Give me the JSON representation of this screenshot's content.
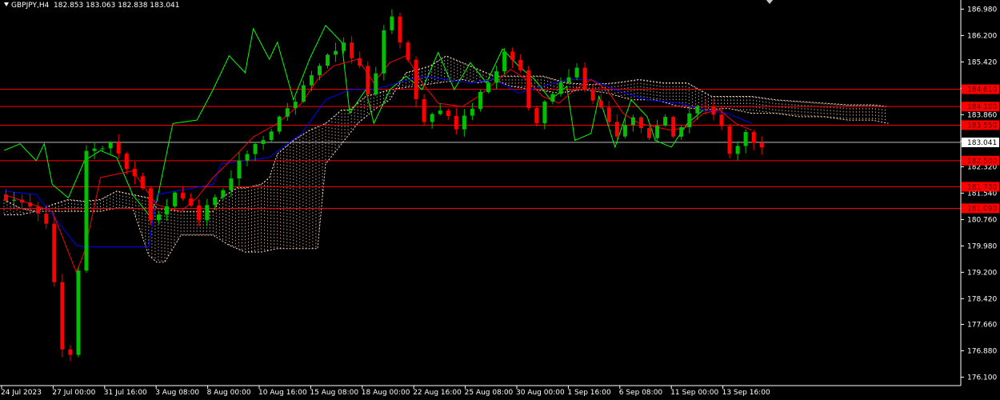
{
  "header": {
    "symbol": "GBPJPY,H4",
    "ohlc": "182.853 183.063 182.838 183.041"
  },
  "colors": {
    "background": "#000000",
    "bull_candle": "#00c000",
    "bear_candle": "#ff0000",
    "tenkan": "#ff0000",
    "kijun": "#0000ff",
    "chikou": "#00ff00",
    "cloud_hatch": "#ffd8c0",
    "level_line": "#ff0000",
    "price_line": "#ffffff",
    "axis": "#ffffff"
  },
  "chart_data": {
    "type": "candlestick",
    "title": "GBPJPY,H4",
    "ylim": [
      175.85,
      187.25
    ],
    "y_ticks": [
      "186.980",
      "186.200",
      "185.420",
      "184.640",
      "183.860",
      "183.080",
      "182.320",
      "181.540",
      "180.760",
      "179.980",
      "179.200",
      "178.420",
      "177.660",
      "176.880",
      "176.100"
    ],
    "x_ticks": [
      "24 Jul 2023",
      "27 Jul 00:00",
      "31 Jul 16:00",
      "3 Aug 08:00",
      "8 Aug 00:00",
      "10 Aug 16:00",
      "15 Aug 08:00",
      "18 Aug 00:00",
      "22 Aug 16:00",
      "25 Aug 08:00",
      "30 Aug 00:00",
      "1 Sep 16:00",
      "6 Sep 08:00",
      "11 Sep 00:00",
      "13 Sep 16:00"
    ],
    "last_price": "183.041",
    "horizontal_levels": [
      "184.610",
      "184.100",
      "183.550",
      "182.500",
      "181.730",
      "181.090"
    ],
    "indicators": [
      "Ichimoku Tenkan-sen",
      "Ichimoku Kijun-sen",
      "Ichimoku Chikou Span",
      "Ichimoku Cloud"
    ],
    "price_path": [
      [
        0,
        181.5
      ],
      [
        4,
        181.2
      ],
      [
        6,
        180.6
      ],
      [
        8,
        177.0
      ],
      [
        9,
        176.7
      ],
      [
        10,
        179.2
      ],
      [
        11,
        182.8
      ],
      [
        14,
        183.0
      ],
      [
        16,
        182.3
      ],
      [
        18,
        181.6
      ],
      [
        19,
        180.8
      ],
      [
        20,
        180.9
      ],
      [
        22,
        181.6
      ],
      [
        24,
        181.2
      ],
      [
        25,
        180.8
      ],
      [
        27,
        181.4
      ],
      [
        29,
        182.0
      ],
      [
        31,
        182.8
      ],
      [
        34,
        183.4
      ],
      [
        36,
        184.0
      ],
      [
        38,
        184.7
      ],
      [
        41,
        185.6
      ],
      [
        43,
        186.0
      ],
      [
        45,
        185.2
      ],
      [
        46,
        184.5
      ],
      [
        47,
        185.0
      ],
      [
        48,
        186.3
      ],
      [
        49,
        186.7
      ],
      [
        51,
        185.4
      ],
      [
        52,
        184.3
      ],
      [
        53,
        183.7
      ],
      [
        55,
        184.0
      ],
      [
        57,
        183.5
      ],
      [
        59,
        184.1
      ],
      [
        61,
        184.8
      ],
      [
        63,
        185.7
      ],
      [
        65,
        185.1
      ],
      [
        66,
        184.0
      ],
      [
        67,
        183.7
      ],
      [
        68,
        184.3
      ],
      [
        70,
        184.8
      ],
      [
        72,
        185.3
      ],
      [
        73,
        184.6
      ],
      [
        75,
        184.0
      ],
      [
        76,
        183.6
      ],
      [
        77,
        183.2
      ],
      [
        79,
        183.7
      ],
      [
        81,
        183.2
      ],
      [
        83,
        183.7
      ],
      [
        84,
        183.1
      ],
      [
        86,
        183.9
      ],
      [
        88,
        184.1
      ],
      [
        90,
        183.5
      ],
      [
        91,
        182.7
      ],
      [
        92,
        182.9
      ],
      [
        93,
        183.3
      ],
      [
        94,
        183.0
      ]
    ],
    "kijun_path": [
      [
        0,
        181.6
      ],
      [
        4,
        181.5
      ],
      [
        8,
        180.3
      ],
      [
        9,
        180.0
      ],
      [
        10,
        179.95
      ],
      [
        18,
        179.95
      ],
      [
        19,
        181.5
      ],
      [
        26,
        181.8
      ],
      [
        27,
        182.4
      ],
      [
        33,
        182.6
      ],
      [
        37,
        183.3
      ],
      [
        40,
        184.3
      ],
      [
        43,
        184.6
      ],
      [
        46,
        184.6
      ],
      [
        49,
        184.8
      ],
      [
        52,
        185.0
      ],
      [
        55,
        184.9
      ],
      [
        58,
        184.8
      ],
      [
        61,
        184.9
      ],
      [
        64,
        184.5
      ],
      [
        67,
        184.7
      ],
      [
        70,
        184.9
      ],
      [
        73,
        184.9
      ],
      [
        76,
        184.6
      ],
      [
        80,
        184.3
      ],
      [
        84,
        184.2
      ],
      [
        87,
        184.0
      ],
      [
        90,
        183.9
      ],
      [
        93,
        183.6
      ]
    ],
    "tenkan_path": [
      [
        0,
        181.5
      ],
      [
        6,
        181.0
      ],
      [
        9,
        179.2
      ],
      [
        10,
        179.8
      ],
      [
        12,
        182.0
      ],
      [
        16,
        182.2
      ],
      [
        19,
        181.2
      ],
      [
        22,
        181.0
      ],
      [
        24,
        181.4
      ],
      [
        26,
        182.0
      ],
      [
        29,
        182.7
      ],
      [
        31,
        183.2
      ],
      [
        34,
        183.6
      ],
      [
        37,
        184.2
      ],
      [
        39,
        184.9
      ],
      [
        41,
        185.3
      ],
      [
        44,
        185.5
      ],
      [
        46,
        184.8
      ],
      [
        48,
        185.4
      ],
      [
        50,
        185.6
      ],
      [
        52,
        184.8
      ],
      [
        54,
        184.2
      ],
      [
        57,
        184.1
      ],
      [
        59,
        184.4
      ],
      [
        61,
        184.8
      ],
      [
        63,
        185.2
      ],
      [
        65,
        184.9
      ],
      [
        67,
        184.4
      ],
      [
        69,
        184.2
      ],
      [
        71,
        184.6
      ],
      [
        73,
        184.9
      ],
      [
        75,
        184.6
      ],
      [
        77,
        183.9
      ],
      [
        79,
        183.6
      ],
      [
        81,
        183.5
      ],
      [
        83,
        183.4
      ],
      [
        85,
        183.5
      ],
      [
        87,
        183.9
      ],
      [
        89,
        184.0
      ],
      [
        91,
        183.6
      ],
      [
        93,
        183.4
      ]
    ],
    "chikou_path": [
      [
        0,
        182.8
      ],
      [
        2,
        183.0
      ],
      [
        4,
        182.5
      ],
      [
        5,
        183.0
      ],
      [
        6,
        181.8
      ],
      [
        8,
        181.4
      ],
      [
        10,
        182.5
      ],
      [
        12,
        182.8
      ],
      [
        14,
        182.6
      ],
      [
        16,
        181.5
      ],
      [
        18,
        180.9
      ],
      [
        19,
        181.3
      ],
      [
        21,
        183.6
      ],
      [
        24,
        183.7
      ],
      [
        26,
        184.6
      ],
      [
        28,
        185.6
      ],
      [
        30,
        185.1
      ],
      [
        31,
        186.4
      ],
      [
        33,
        185.5
      ],
      [
        34,
        186.0
      ],
      [
        36,
        184.3
      ],
      [
        38,
        185.5
      ],
      [
        40,
        186.5
      ],
      [
        42,
        186.0
      ],
      [
        43,
        183.9
      ],
      [
        45,
        184.6
      ],
      [
        46,
        183.6
      ],
      [
        48,
        184.6
      ],
      [
        50,
        185.0
      ],
      [
        52,
        184.6
      ],
      [
        54,
        185.7
      ],
      [
        56,
        184.6
      ],
      [
        58,
        185.4
      ],
      [
        60,
        184.8
      ],
      [
        62,
        185.8
      ],
      [
        64,
        185.3
      ],
      [
        66,
        184.9
      ],
      [
        68,
        184.3
      ],
      [
        70,
        184.7
      ],
      [
        71,
        183.1
      ],
      [
        73,
        183.3
      ],
      [
        74,
        184.4
      ],
      [
        76,
        182.9
      ],
      [
        78,
        184.3
      ],
      [
        80,
        183.8
      ],
      [
        81,
        183.1
      ],
      [
        83,
        182.9
      ],
      [
        85,
        183.6
      ],
      [
        87,
        184.0
      ]
    ],
    "span_a_path": [
      [
        0,
        181.35
      ],
      [
        2,
        181.1
      ],
      [
        4,
        181.0
      ],
      [
        6,
        181.2
      ],
      [
        8,
        181.35
      ],
      [
        10,
        181.3
      ],
      [
        12,
        181.35
      ],
      [
        14,
        181.6
      ],
      [
        18,
        181.4
      ],
      [
        19,
        181.1
      ],
      [
        22,
        181.0
      ],
      [
        24,
        181.0
      ],
      [
        26,
        181.0
      ],
      [
        27,
        181.4
      ],
      [
        29,
        181.7
      ],
      [
        30,
        181.7
      ],
      [
        32,
        181.8
      ],
      [
        33,
        182.0
      ],
      [
        34,
        182.7
      ],
      [
        36,
        183.1
      ],
      [
        38,
        183.4
      ],
      [
        40,
        183.6
      ],
      [
        42,
        184.0
      ],
      [
        43,
        184.0
      ],
      [
        45,
        184.4
      ],
      [
        48,
        184.6
      ],
      [
        51,
        184.7
      ],
      [
        54,
        184.8
      ],
      [
        57,
        184.9
      ],
      [
        59,
        184.8
      ],
      [
        61,
        184.9
      ],
      [
        63,
        184.7
      ],
      [
        66,
        184.6
      ],
      [
        69,
        184.5
      ],
      [
        72,
        184.6
      ],
      [
        75,
        184.5
      ],
      [
        78,
        184.3
      ],
      [
        81,
        184.3
      ],
      [
        84,
        184.1
      ],
      [
        87,
        184.0
      ],
      [
        90,
        184.05
      ],
      [
        93,
        183.9
      ],
      [
        96,
        183.9
      ],
      [
        99,
        183.8
      ],
      [
        102,
        183.8
      ],
      [
        105,
        183.7
      ],
      [
        108,
        183.7
      ],
      [
        110,
        183.6
      ]
    ],
    "span_b_path": [
      [
        0,
        180.9
      ],
      [
        2,
        180.9
      ],
      [
        4,
        181.0
      ],
      [
        6,
        181.0
      ],
      [
        8,
        181.0
      ],
      [
        10,
        181.0
      ],
      [
        12,
        181.0
      ],
      [
        14,
        181.1
      ],
      [
        16,
        181.1
      ],
      [
        18,
        179.7
      ],
      [
        19,
        179.5
      ],
      [
        20,
        179.5
      ],
      [
        22,
        180.3
      ],
      [
        24,
        180.3
      ],
      [
        26,
        180.3
      ],
      [
        28,
        180.0
      ],
      [
        30,
        179.8
      ],
      [
        32,
        179.8
      ],
      [
        34,
        179.9
      ],
      [
        36,
        179.9
      ],
      [
        38,
        179.9
      ],
      [
        39,
        179.9
      ],
      [
        40,
        182.4
      ],
      [
        42,
        183.0
      ],
      [
        44,
        183.6
      ],
      [
        46,
        184.0
      ],
      [
        48,
        184.3
      ],
      [
        50,
        185.1
      ],
      [
        53,
        185.3
      ],
      [
        55,
        185.6
      ],
      [
        58,
        185.3
      ],
      [
        61,
        185.0
      ],
      [
        64,
        185.0
      ],
      [
        67,
        185.0
      ],
      [
        70,
        184.8
      ],
      [
        73,
        184.75
      ],
      [
        76,
        184.8
      ],
      [
        79,
        184.9
      ],
      [
        82,
        184.8
      ],
      [
        85,
        184.8
      ],
      [
        88,
        184.4
      ],
      [
        90,
        184.4
      ],
      [
        93,
        184.4
      ],
      [
        96,
        184.3
      ],
      [
        99,
        184.25
      ],
      [
        102,
        184.2
      ],
      [
        105,
        184.15
      ],
      [
        108,
        184.15
      ],
      [
        110,
        184.1
      ]
    ]
  }
}
